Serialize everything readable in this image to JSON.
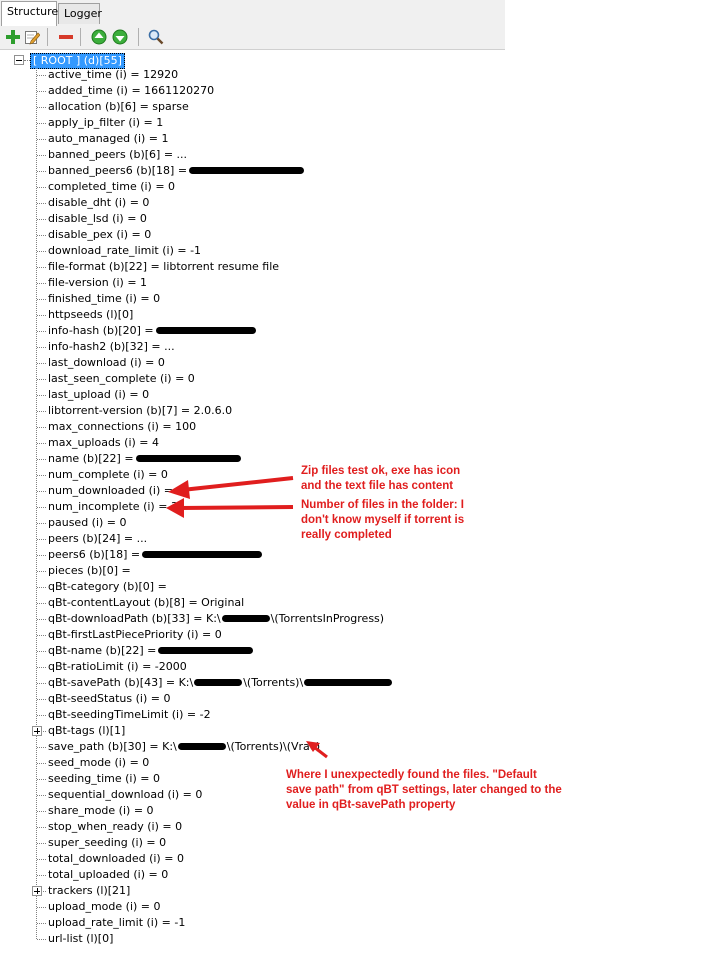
{
  "tabs": [
    {
      "label": "Structure",
      "active": true
    },
    {
      "label": "Logger",
      "active": false
    }
  ],
  "toolbar": {
    "icons": [
      "add-icon",
      "edit-icon",
      "remove-icon",
      "move-up-icon",
      "move-down-icon",
      "search-icon"
    ]
  },
  "root": {
    "label": "[ ROOT ] (d)[55]"
  },
  "nodes": [
    {
      "label": "active_time (i) = 12920"
    },
    {
      "label": "added_time (i) = 1661120270"
    },
    {
      "label": "allocation (b)[6] = sparse"
    },
    {
      "label": "apply_ip_filter (i) = 1"
    },
    {
      "label": "auto_managed (i) = 1"
    },
    {
      "label": "banned_peers (b)[6] = ..."
    },
    {
      "label": "banned_peers6 (b)[18] =",
      "redacted": true
    },
    {
      "label": "completed_time (i) = 0"
    },
    {
      "label": "disable_dht (i) = 0"
    },
    {
      "label": "disable_lsd (i) = 0"
    },
    {
      "label": "disable_pex (i) = 0"
    },
    {
      "label": "download_rate_limit (i) = -1"
    },
    {
      "label": "file-format (b)[22] = libtorrent resume file"
    },
    {
      "label": "file-version (i) = 1"
    },
    {
      "label": "finished_time (i) = 0"
    },
    {
      "label": "httpseeds (l)[0]"
    },
    {
      "label": "info-hash (b)[20] =",
      "redacted": true
    },
    {
      "label": "info-hash2 (b)[32] = ..."
    },
    {
      "label": "last_download (i) = 0"
    },
    {
      "label": "last_seen_complete (i) = 0"
    },
    {
      "label": "last_upload (i) = 0"
    },
    {
      "label": "libtorrent-version (b)[7] = 2.0.6.0"
    },
    {
      "label": "max_connections (i) = 100"
    },
    {
      "label": "max_uploads (i) = 4"
    },
    {
      "label": "name (b)[22] =",
      "redacted": true
    },
    {
      "label": "num_complete (i) = 0"
    },
    {
      "label": "num_downloaded (i) = 0"
    },
    {
      "label": "num_incomplete (i) = 3"
    },
    {
      "label": "paused (i) = 0"
    },
    {
      "label": "peers (b)[24] = ..."
    },
    {
      "label": "peers6 (b)[18] =",
      "redacted": true
    },
    {
      "label": "pieces (b)[0] ="
    },
    {
      "label": "qBt-category (b)[0] ="
    },
    {
      "label": "qBt-contentLayout (b)[8] = Original"
    },
    {
      "label": "qBt-downloadPath (b)[33] = K:\\",
      "redacted_mid": true,
      "suffix": "\\(TorrentsInProgress)"
    },
    {
      "label": "qBt-firstLastPiecePriority (i) = 0"
    },
    {
      "label": "qBt-name (b)[22] =",
      "redacted": true
    },
    {
      "label": "qBt-ratioLimit (i) = -2000"
    },
    {
      "label": "qBt-savePath (b)[43] = K:\\",
      "redacted_mid": true,
      "suffix": "\\(Torrents)\\",
      "redacted_end": true
    },
    {
      "label": "qBt-seedStatus (i) = 0"
    },
    {
      "label": "qBt-seedingTimeLimit (i) = -2"
    },
    {
      "label": "qBt-tags (l)[1]",
      "expandable": true
    },
    {
      "label": "save_path (b)[30] = K:\\",
      "redacted_mid": true,
      "suffix": "\\(Torrents)\\(Vrac)"
    },
    {
      "label": "seed_mode (i) = 0"
    },
    {
      "label": "seeding_time (i) = 0"
    },
    {
      "label": "sequential_download (i) = 0"
    },
    {
      "label": "share_mode (i) = 0"
    },
    {
      "label": "stop_when_ready (i) = 0"
    },
    {
      "label": "super_seeding (i) = 0"
    },
    {
      "label": "total_downloaded (i) = 0"
    },
    {
      "label": "total_uploaded (i) = 0"
    },
    {
      "label": "trackers (l)[21]",
      "expandable": true
    },
    {
      "label": "upload_mode (i) = 0"
    },
    {
      "label": "upload_rate_limit (i) = -1"
    },
    {
      "label": "url-list (l)[0]"
    }
  ],
  "annotations": {
    "note1": [
      "Zip files test ok, exe has icon",
      "and the text file has content"
    ],
    "note2": [
      "Number of files in the folder: I",
      "don't know myself if torrent is",
      "really completed"
    ],
    "note3": [
      "Where I unexpectedly found the files. \"Default",
      "save path\" from qBT settings, later changed to the",
      "value in qBt-savePath property"
    ]
  },
  "colors": {
    "annotation": "#e01e1e",
    "selection": "#3399ff"
  }
}
